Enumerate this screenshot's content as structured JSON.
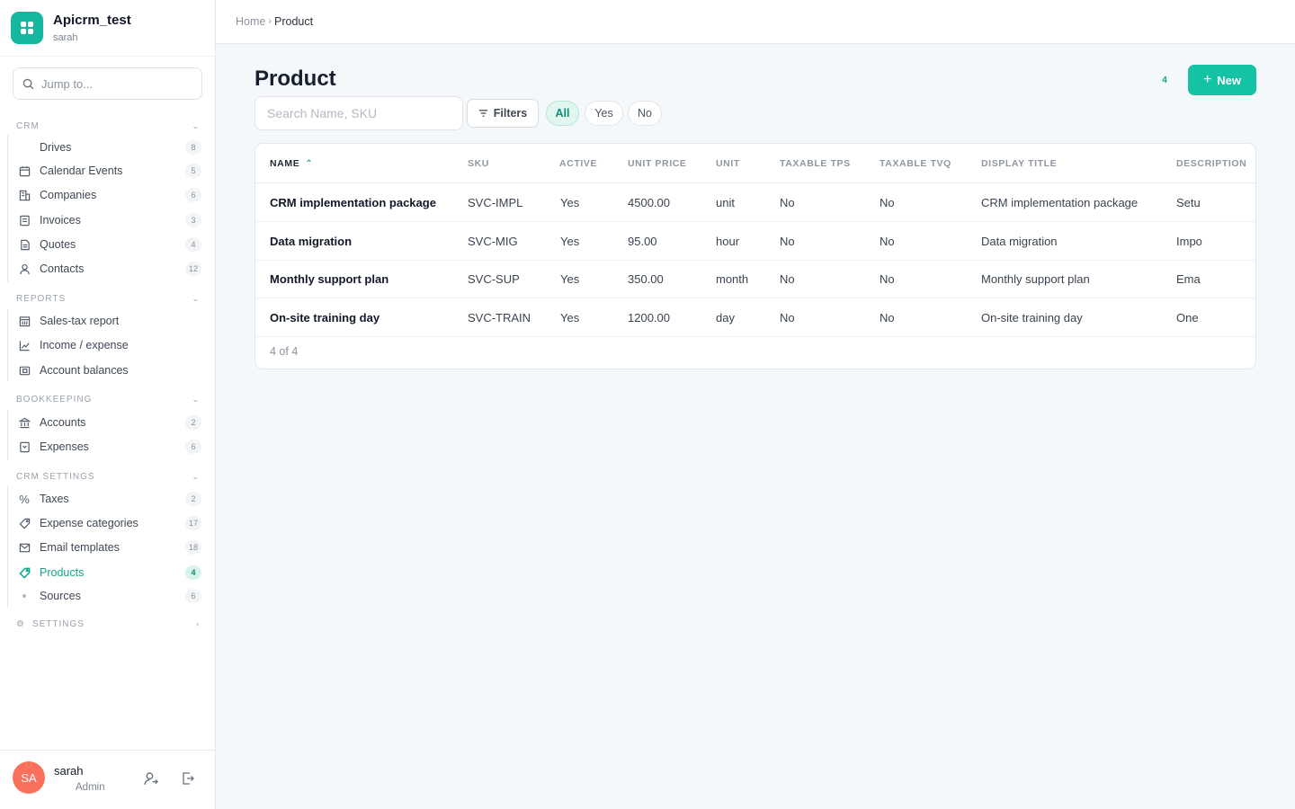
{
  "app": {
    "title": "Apicrm_test",
    "subtitle": "sarah"
  },
  "sidebar": {
    "jump_placeholder": "Jump to...",
    "sections": {
      "crm": "CRM",
      "reports": "REPORTS",
      "bookkeeping": "BOOKKEEPING",
      "crm_settings": "CRM SETTINGS",
      "settings": "SETTINGS"
    },
    "crm_items": [
      {
        "label": "Drives",
        "count": "8",
        "icon": "none"
      },
      {
        "label": "Calendar Events",
        "count": "5",
        "icon": "calendar-icon"
      },
      {
        "label": "Companies",
        "count": "6",
        "icon": "building-icon"
      },
      {
        "label": "Invoices",
        "count": "3",
        "icon": "invoice-icon"
      },
      {
        "label": "Quotes",
        "count": "4",
        "icon": "quote-icon"
      },
      {
        "label": "Contacts",
        "count": "12",
        "icon": "person-icon"
      }
    ],
    "report_items": [
      {
        "label": "Sales-tax report",
        "icon": "bank-icon"
      },
      {
        "label": "Income / expense",
        "icon": "line-chart-icon"
      },
      {
        "label": "Account balances",
        "icon": "wallet-icon"
      }
    ],
    "bookkeeping_items": [
      {
        "label": "Accounts",
        "count": "2",
        "icon": "bank-icon"
      },
      {
        "label": "Expenses",
        "count": "6",
        "icon": "receipt-icon"
      }
    ],
    "settings_items": [
      {
        "label": "Taxes",
        "count": "2",
        "icon": "percent-icon"
      },
      {
        "label": "Expense categories",
        "count": "17",
        "icon": "tag-icon"
      },
      {
        "label": "Email templates",
        "count": "18",
        "icon": "mail-icon"
      },
      {
        "label": "Products",
        "count": "4",
        "icon": "tag-icon",
        "active": true
      },
      {
        "label": "Sources",
        "count": "6",
        "icon": "dot-icon"
      }
    ]
  },
  "user": {
    "initials": "SA",
    "name": "sarah",
    "role": "Admin",
    "avatar_color": "#fb6f5d"
  },
  "breadcrumb": {
    "home": "Home",
    "separator": "›",
    "current": "Product"
  },
  "page": {
    "title": "Product",
    "count": "4",
    "new_label": "New",
    "search_placeholder": "Search Name, SKU",
    "filters_label": "Filters",
    "pills": [
      "All",
      "Yes",
      "No"
    ],
    "active_pill": "All"
  },
  "table": {
    "columns": [
      "NAME",
      "SKU",
      "ACTIVE",
      "UNIT PRICE",
      "UNIT",
      "TAXABLE TPS",
      "TAXABLE TVQ",
      "DISPLAY TITLE",
      "DESCRIPTION"
    ],
    "sorted_column": "NAME",
    "rows": [
      [
        "CRM implementation package",
        "SVC-IMPL",
        "Yes",
        "4500.00",
        "unit",
        "No",
        "No",
        "CRM implementation package",
        "Setu"
      ],
      [
        "Data migration",
        "SVC-MIG",
        "Yes",
        "95.00",
        "hour",
        "No",
        "No",
        "Data migration",
        "Impo"
      ],
      [
        "Monthly support plan",
        "SVC-SUP",
        "Yes",
        "350.00",
        "month",
        "No",
        "No",
        "Monthly support plan",
        "Ema"
      ],
      [
        "On-site training day",
        "SVC-TRAIN",
        "Yes",
        "1200.00",
        "day",
        "No",
        "No",
        "On-site training day",
        "One"
      ]
    ],
    "footer": "4 of 4"
  },
  "colors": {
    "accent": "#14c3a3",
    "accent_text": "#0fa58b"
  }
}
